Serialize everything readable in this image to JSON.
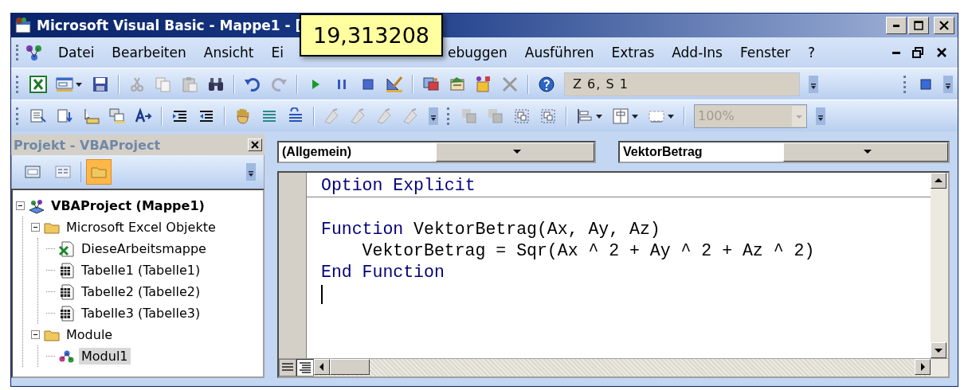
{
  "window": {
    "title": "Microsoft Visual Basic - Mappe1 - ["
  },
  "tooltip": "19,313208",
  "menu_before_tooltip": [
    "Datei",
    "Bearbeiten",
    "Ansicht",
    "Ei"
  ],
  "menu_after_tooltip": [
    "ebuggen",
    "Ausführen",
    "Extras",
    "Add-Ins",
    "Fenster",
    "?"
  ],
  "position": "Z 6, S 1",
  "zoom": {
    "value": "100%",
    "disabled": true
  },
  "project": {
    "title": "Projekt - VBAProject",
    "view_buttons": [
      {
        "selected": false
      },
      {
        "selected": false
      },
      {
        "selected": true
      }
    ],
    "tree": [
      {
        "label": "VBAProject (Mappe1)",
        "kind": "project",
        "expanded": true,
        "selected": false,
        "children": [
          {
            "label": "Microsoft Excel Objekte",
            "kind": "folder",
            "expanded": true,
            "selected": false,
            "children": [
              {
                "label": "DieseArbeitsmappe",
                "kind": "workbook",
                "selected": false
              },
              {
                "label": "Tabelle1 (Tabelle1)",
                "kind": "sheet",
                "selected": false
              },
              {
                "label": "Tabelle2 (Tabelle2)",
                "kind": "sheet",
                "selected": false
              },
              {
                "label": "Tabelle3 (Tabelle3)",
                "kind": "sheet",
                "selected": false
              }
            ]
          },
          {
            "label": "Module",
            "kind": "folder",
            "expanded": true,
            "selected": false,
            "children": [
              {
                "label": "Modul1",
                "kind": "module",
                "selected": true
              }
            ]
          }
        ]
      }
    ]
  },
  "code": {
    "object_box": "(Allgemein)",
    "procedure_box": "VektorBetrag",
    "lines": [
      {
        "kind": "code",
        "indented": false,
        "separator_below": true,
        "tokens": [
          {
            "kind": "keyword",
            "text": "Option Explicit"
          }
        ]
      },
      {
        "kind": "blank"
      },
      {
        "kind": "code",
        "indented": false,
        "separator_below": false,
        "tokens": [
          {
            "kind": "keyword",
            "text": "Function"
          },
          {
            "kind": "plain",
            "text": " VektorBetrag(Ax, Ay, Az)"
          }
        ]
      },
      {
        "kind": "code",
        "indented": true,
        "separator_below": false,
        "tokens": [
          {
            "kind": "plain",
            "text": "VektorBetrag = Sqr(Ax ^ 2 + Ay ^ 2 + Az ^ 2)"
          }
        ]
      },
      {
        "kind": "code",
        "indented": false,
        "separator_below": false,
        "tokens": [
          {
            "kind": "keyword",
            "text": "End Function"
          }
        ]
      },
      {
        "kind": "cursor"
      }
    ],
    "view_buttons": [
      {
        "selected": false
      },
      {
        "selected": true
      }
    ]
  }
}
